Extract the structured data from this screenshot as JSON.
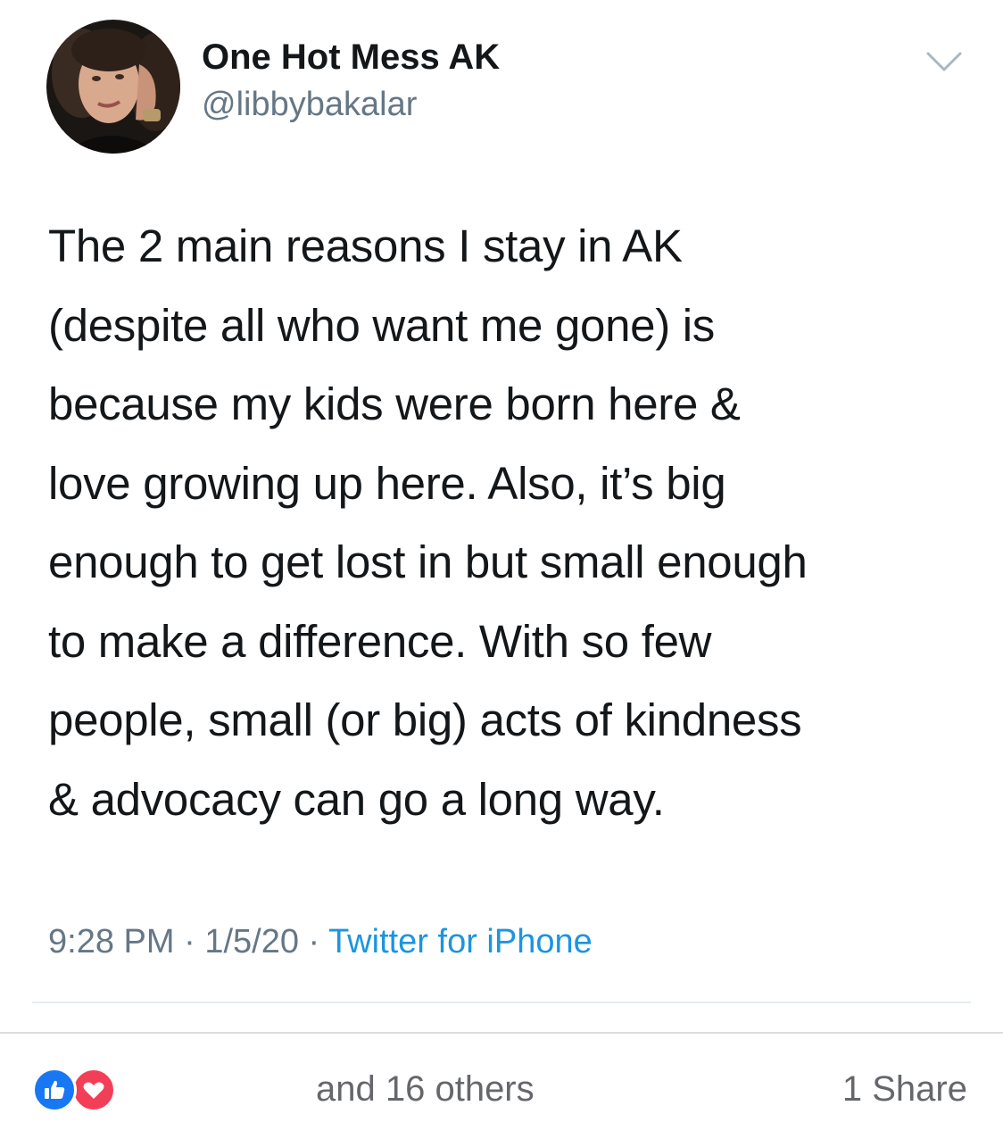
{
  "tweet": {
    "display_name": "One Hot Mess AK",
    "handle": "@libbybakalar",
    "avatar_icon": "profile-photo",
    "text_lines": [
      "The 2 main reasons I stay in AK",
      "(despite all who want me gone) is",
      "because my kids were born here &",
      "love growing up here. Also, it’s big",
      "enough to get lost in but small enough",
      "to make a difference. With so few",
      "people, small (or big) acts of kindness",
      "& advocacy can go a long way."
    ],
    "time": "9:28 PM",
    "date": "1/5/20",
    "separator": " · ",
    "source": "Twitter for iPhone"
  },
  "footer": {
    "reaction_icons": [
      "like-icon",
      "love-icon"
    ],
    "reaction_text": "and 16 others",
    "share_text": "1 Share"
  },
  "colors": {
    "text": "#14171a",
    "secondary": "#657786",
    "link": "#1b95e0",
    "like": "#1877f2",
    "love": "#f33e58"
  }
}
